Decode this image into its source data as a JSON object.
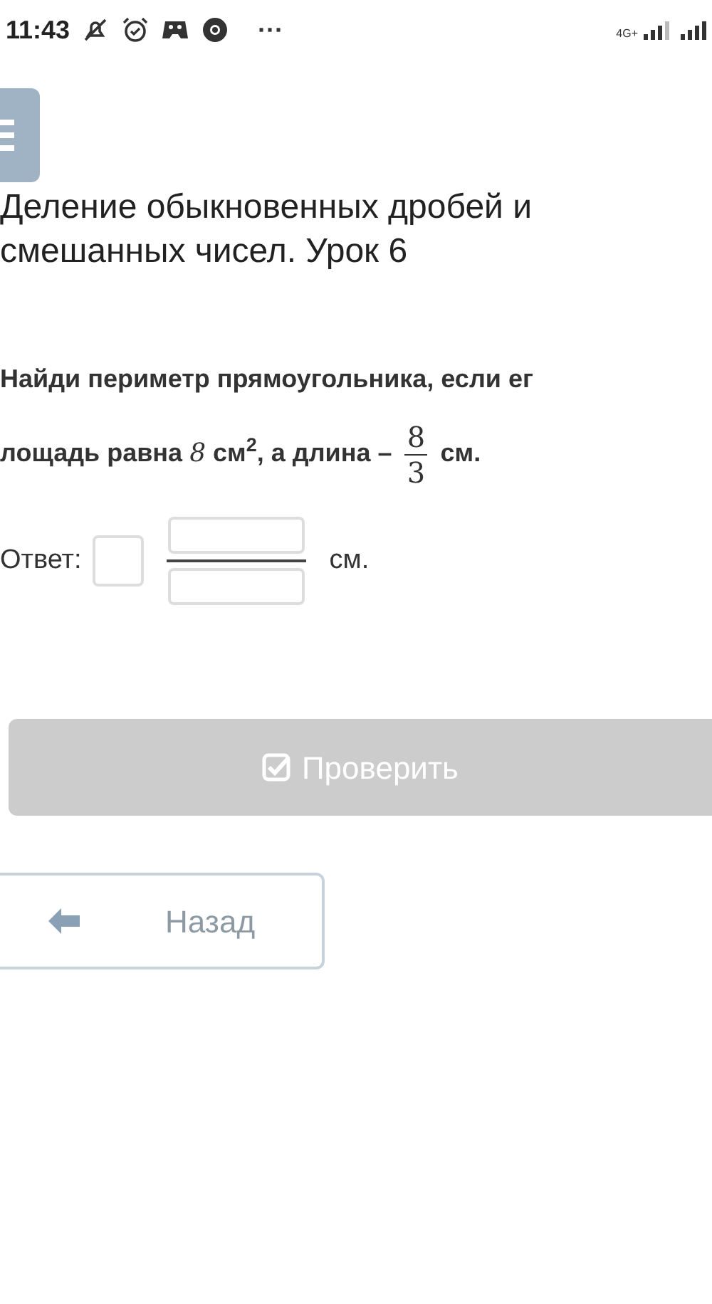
{
  "status_bar": {
    "time": "11:43",
    "more": "···",
    "network": "4G+"
  },
  "lesson_title": "Деление обыкновенных дробей и смешанных чисел. Урок 6",
  "question": {
    "line_1": "Найди периметр прямоугольника, если ег",
    "prefix": "лощадь равна",
    "area": "8",
    "area_unit": "см$^{2}$",
    "middle": ", а длина –",
    "numerator": "8",
    "denominator": "3",
    "suffix": "см."
  },
  "answer": {
    "label": "Ответ:",
    "unit": "см."
  },
  "check_button": {
    "label": "Проверить",
    "disabled": true
  },
  "back_button": {
    "label": "Назад"
  }
}
